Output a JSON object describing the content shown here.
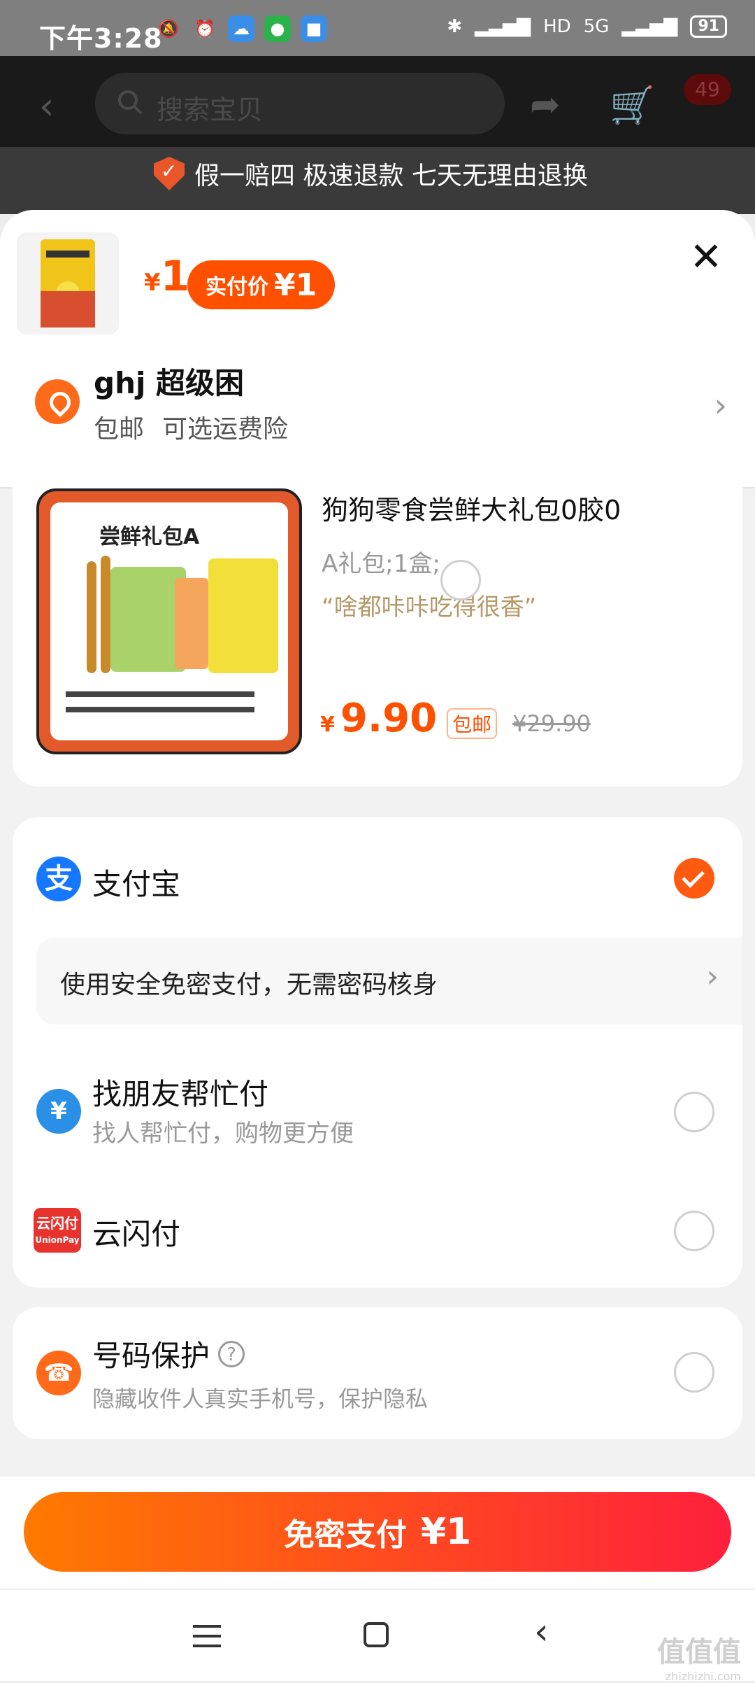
{
  "status_bar": {
    "time": "下午3:28",
    "network": "5G",
    "battery": "91"
  },
  "background_page": {
    "search_placeholder": "搜索宝贝",
    "cart_badge": "49",
    "guarantee_text": "假一赔四 极速退款 七天无理由退换"
  },
  "sheet": {
    "price_symbol": "¥",
    "price": "1",
    "actual_pay_label": "实付价",
    "actual_pay_value": "¥1",
    "address_name": "ghj 超级困",
    "shipping": "包邮",
    "insurance": "可选运费险"
  },
  "product": {
    "image_label": "尝鲜礼包A",
    "title": "狗狗零食尝鲜大礼包0胶0",
    "sku": "A礼包;1盒;",
    "quote": "“啥都咔咔吃得很香”",
    "price_symbol": "¥",
    "price": "9.90",
    "tag": "包邮",
    "original_price": "¥29.90"
  },
  "payments": {
    "alipay_label": "支付宝",
    "tip": "使用安全免密支付，无需密码核身",
    "friend_label": "找朋友帮忙付",
    "friend_sub": "找人帮忙付，购物更方便",
    "union_label": "云闪付",
    "union_icon_text": "云闪付",
    "union_icon_sub": "UnionPay"
  },
  "number_protection": {
    "label": "号码保护",
    "sub": "隐藏收件人真实手机号，保护隐私"
  },
  "pay_button": {
    "label": "免密支付",
    "value": "¥1"
  },
  "watermark": {
    "text": "值值值",
    "sub": "zhizhizhi.com"
  },
  "colors": {
    "accent": "#ff5000",
    "alipay_blue": "#1677ff",
    "button_gradient_start": "#ff7a00",
    "button_gradient_end": "#ff1f3d"
  }
}
